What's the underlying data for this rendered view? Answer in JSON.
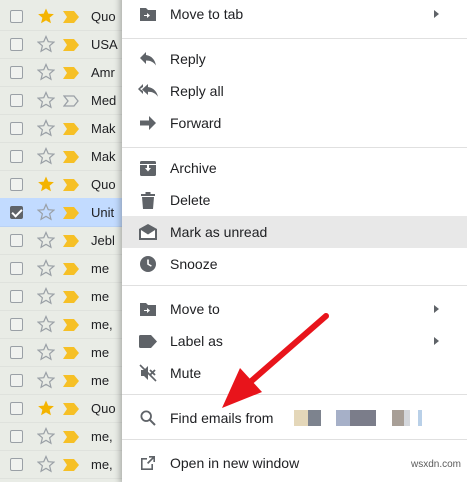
{
  "email_rows": [
    {
      "sender": "Quo",
      "starred": true,
      "selected": false,
      "important": true
    },
    {
      "sender": "USA",
      "starred": false,
      "selected": false,
      "important": true
    },
    {
      "sender": "Amr",
      "starred": false,
      "selected": false,
      "important": true
    },
    {
      "sender": "Med",
      "starred": false,
      "selected": false,
      "important": false
    },
    {
      "sender": "Mak",
      "starred": false,
      "selected": false,
      "important": true
    },
    {
      "sender": "Mak",
      "starred": false,
      "selected": false,
      "important": true
    },
    {
      "sender": "Quo",
      "starred": true,
      "selected": false,
      "important": true
    },
    {
      "sender": "Unit",
      "starred": false,
      "selected": true,
      "important": true
    },
    {
      "sender": "Jebl",
      "starred": false,
      "selected": false,
      "important": true
    },
    {
      "sender": "me",
      "starred": false,
      "selected": false,
      "important": true
    },
    {
      "sender": "me",
      "starred": false,
      "selected": false,
      "important": true
    },
    {
      "sender": "me,",
      "starred": false,
      "selected": false,
      "important": true
    },
    {
      "sender": "me",
      "starred": false,
      "selected": false,
      "important": true
    },
    {
      "sender": "me",
      "starred": false,
      "selected": false,
      "important": true
    },
    {
      "sender": "Quo",
      "starred": true,
      "selected": false,
      "important": true
    },
    {
      "sender": "me,",
      "starred": false,
      "selected": false,
      "important": true
    },
    {
      "sender": "me,",
      "starred": false,
      "selected": false,
      "important": true
    }
  ],
  "context_menu": {
    "move_to_tab": "Move to tab",
    "reply": "Reply",
    "reply_all": "Reply all",
    "forward": "Forward",
    "archive": "Archive",
    "delete": "Delete",
    "mark_as_unread": "Mark as unread",
    "snooze": "Snooze",
    "move_to": "Move to",
    "label_as": "Label as",
    "mute": "Mute",
    "find_emails_from": "Find emails from",
    "open_in_new_window": "Open in new window"
  },
  "colors": {
    "star": "#f4b400",
    "important": "#f6c026",
    "annotation_arrow": "#e8141b",
    "selected_row": "#c2dbff"
  },
  "watermark": "wsxdn.com"
}
